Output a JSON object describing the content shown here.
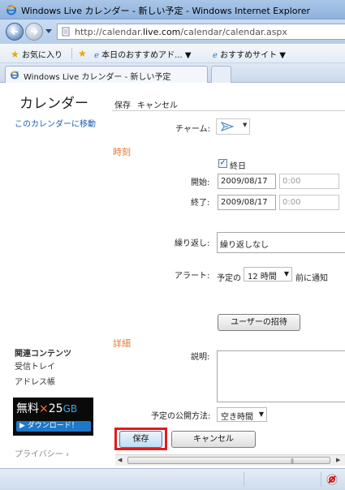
{
  "browser": {
    "title": "Windows Live カレンダー - 新しい予定 - Windows Internet Explorer",
    "url_prefix": "http://calendar.",
    "url_domain": "live.com",
    "url_path": "/calendar/calendar.aspx",
    "favorites_label": "お気に入り",
    "fav_link1": "本日のおすすめアド...",
    "fav_link2": "おすすめサイト",
    "tab_label": "Windows Live カレンダー - 新しい予定"
  },
  "sidebar": {
    "title": "カレンダー",
    "goto_link": "このカレンダーに移動",
    "related_heading": "関連コンテンツ",
    "related_links": [
      "受信トレイ",
      "アドレス帳"
    ],
    "ad_text_free": "無料",
    "ad_text_x": "×",
    "ad_text_size": "25",
    "ad_text_unit": "GB",
    "ad_button": "▶ ダウンロード！",
    "privacy": "プライバシー"
  },
  "form": {
    "top_save": "保存",
    "top_cancel": "キャンセル",
    "charm_label": "チャーム:",
    "time_section": "時刻",
    "allday_label": "終日",
    "allday_checked": true,
    "start_label": "開始:",
    "start_date": "2009/08/17",
    "start_time": "0:00",
    "end_label": "終了:",
    "end_date": "2009/08/17",
    "end_time": "0:00",
    "repeat_label": "繰り返し:",
    "repeat_value": "繰り返しなし",
    "alert_label": "アラート:",
    "alert_prefix": "予定の",
    "alert_value": "12 時間",
    "alert_suffix": "前に通知",
    "invite_button": "ユーザーの招待",
    "detail_section": "詳細",
    "desc_label": "説明:",
    "visibility_label": "予定の公開方法:",
    "visibility_value": "空き時間",
    "save_button": "保存",
    "cancel_button": "キャンセル"
  },
  "colors": {
    "section_heading": "#e07a3a",
    "link": "#1a5fb4",
    "highlight_border": "#e81818"
  }
}
